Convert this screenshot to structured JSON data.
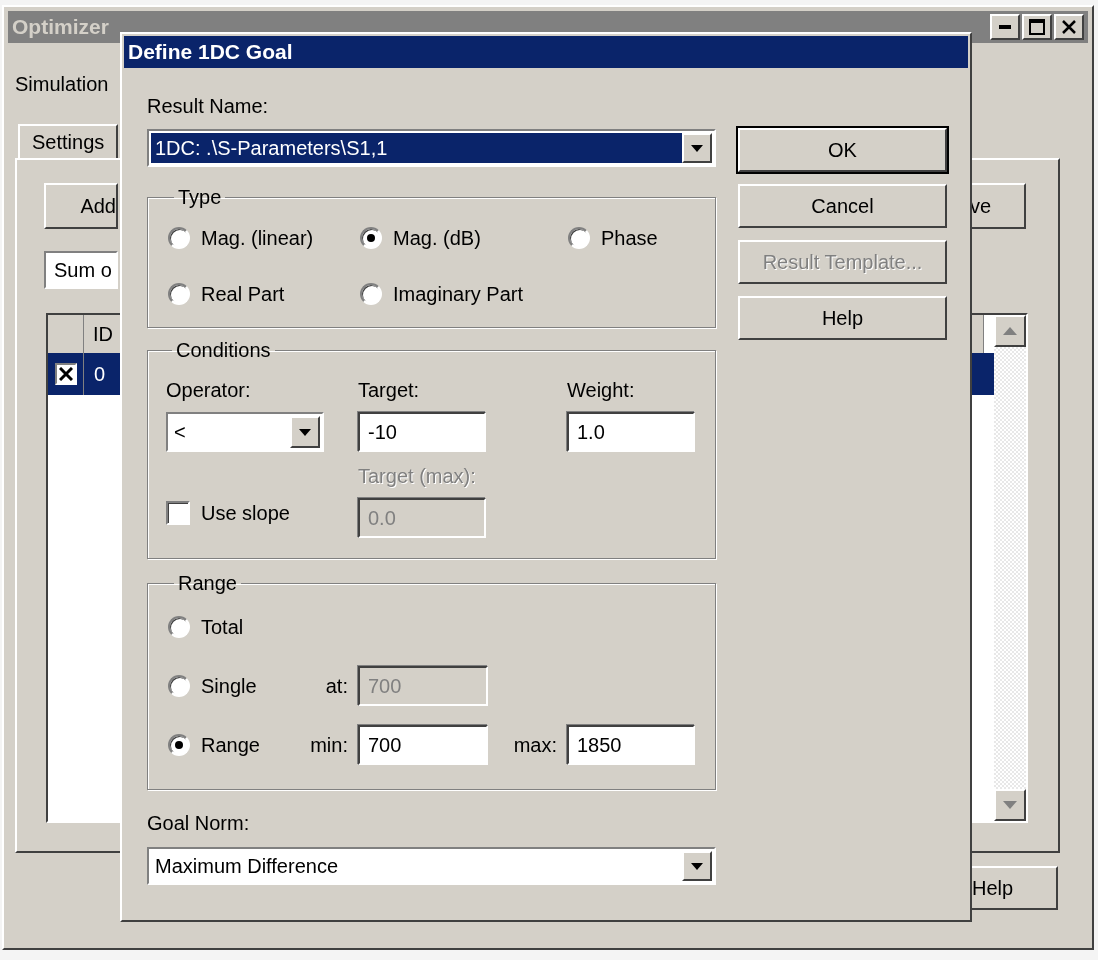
{
  "main_window": {
    "title": "Optimizer",
    "simulation_label": "Simulation",
    "tabs": [
      {
        "label": "Settings",
        "selected": true
      }
    ],
    "add_button": "Add",
    "remove_button": "ve",
    "goal_type_select": "Sum o",
    "table": {
      "columns": [
        "ID"
      ],
      "rows": [
        {
          "checked": true,
          "selected": true,
          "cells": [
            "0"
          ]
        }
      ]
    },
    "help_button": "Help"
  },
  "dialog": {
    "title": "Define 1DC Goal",
    "result_name": {
      "label": "Result Name:",
      "value": "1DC: .\\S-Parameters\\S1,1"
    },
    "type": {
      "label": "Type",
      "options": [
        {
          "label": "Mag. (linear)",
          "selected": false
        },
        {
          "label": "Mag. (dB)",
          "selected": true
        },
        {
          "label": "Phase",
          "selected": false
        },
        {
          "label": "Real Part",
          "selected": false
        },
        {
          "label": "Imaginary Part",
          "selected": false
        }
      ]
    },
    "conditions": {
      "label": "Conditions",
      "operator": {
        "label": "Operator:",
        "value": "<"
      },
      "target": {
        "label": "Target:",
        "value": "-10"
      },
      "weight": {
        "label": "Weight:",
        "value": "1.0"
      },
      "target_max": {
        "label": "Target (max):",
        "value": "0.0",
        "disabled": true
      },
      "use_slope": {
        "label": "Use slope",
        "checked": false
      }
    },
    "range": {
      "label": "Range",
      "options": [
        {
          "label": "Total",
          "selected": false
        },
        {
          "label": "Single",
          "selected": false,
          "fields": [
            {
              "label": "at:",
              "value": "700",
              "disabled": true
            }
          ]
        },
        {
          "label": "Range",
          "selected": true,
          "fields": [
            {
              "label": "min:",
              "value": "700",
              "disabled": false
            },
            {
              "label": "max:",
              "value": "1850",
              "disabled": false
            }
          ]
        }
      ]
    },
    "goal_norm": {
      "label": "Goal Norm:",
      "value": "Maximum Difference"
    },
    "buttons": [
      {
        "label": "OK",
        "default": true,
        "disabled": false
      },
      {
        "label": "Cancel",
        "default": false,
        "disabled": false
      },
      {
        "label": "Result Template...",
        "default": false,
        "disabled": true
      },
      {
        "label": "Help",
        "default": false,
        "disabled": false
      }
    ]
  }
}
